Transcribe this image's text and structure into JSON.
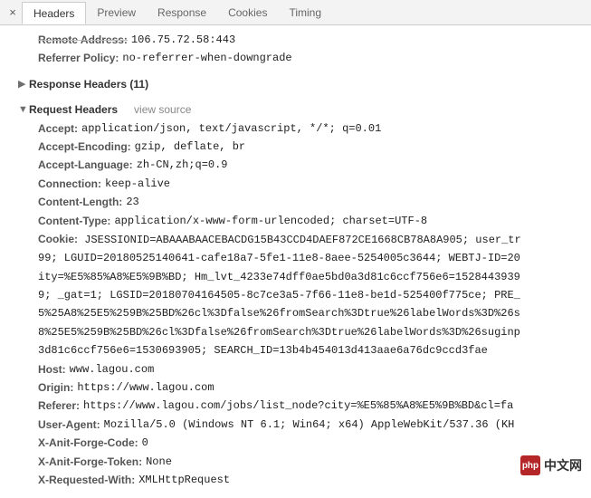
{
  "tabs": {
    "close": "×",
    "items": [
      "Headers",
      "Preview",
      "Response",
      "Cookies",
      "Timing"
    ]
  },
  "general": {
    "remote_address_label": "Remote Address:",
    "remote_address_value": "106.75.72.58:443",
    "referrer_policy_label": "Referrer Policy:",
    "referrer_policy_value": "no-referrer-when-downgrade"
  },
  "response_section": {
    "arrow": "▶",
    "title": "Response Headers (11)"
  },
  "request_section": {
    "arrow": "▼",
    "title": "Request Headers",
    "view_source": "view source"
  },
  "headers": {
    "accept": {
      "label": "Accept:",
      "value": "application/json, text/javascript, */*; q=0.01"
    },
    "accept_encoding": {
      "label": "Accept-Encoding:",
      "value": "gzip, deflate, br"
    },
    "accept_language": {
      "label": "Accept-Language:",
      "value": "zh-CN,zh;q=0.9"
    },
    "connection": {
      "label": "Connection:",
      "value": "keep-alive"
    },
    "content_length": {
      "label": "Content-Length:",
      "value": "23"
    },
    "content_type": {
      "label": "Content-Type:",
      "value": "application/x-www-form-urlencoded; charset=UTF-8"
    },
    "cookie_label": "Cookie:",
    "cookie_value": " JSESSIONID=ABAAABAACEBACDG15B43CCD4DAEF872CE1668CB78A8A905; user_tr\n99; LGUID=20180525140641-cafe18a7-5fe1-11e8-8aee-5254005c3644; WEBTJ-ID=20\nity=%E5%85%A8%E5%9B%BD; Hm_lvt_4233e74dff0ae5bd0a3d81c6ccf756e6=1528443939\n9; _gat=1; LGSID=20180704164505-8c7ce3a5-7f66-11e8-be1d-525400f775ce; PRE_\n5%25A8%25E5%259B%25BD%26cl%3Dfalse%26fromSearch%3Dtrue%26labelWords%3D%26s\n8%25E5%259B%25BD%26cl%3Dfalse%26fromSearch%3Dtrue%26labelWords%3D%26suginp\n3d81c6ccf756e6=1530693905; SEARCH_ID=13b4b454013d413aae6a76dc9ccd3fae",
    "host": {
      "label": "Host:",
      "value": "www.lagou.com"
    },
    "origin": {
      "label": "Origin:",
      "value": "https://www.lagou.com"
    },
    "referer": {
      "label": "Referer:",
      "value": "https://www.lagou.com/jobs/list_node?city=%E5%85%A8%E5%9B%BD&cl=fa"
    },
    "user_agent": {
      "label": "User-Agent:",
      "value": "Mozilla/5.0 (Windows NT 6.1; Win64; x64) AppleWebKit/537.36 (KH"
    },
    "x_anit_forge_code": {
      "label": "X-Anit-Forge-Code:",
      "value": "0"
    },
    "x_anit_forge_token": {
      "label": "X-Anit-Forge-Token:",
      "value": "None"
    },
    "x_requested_with": {
      "label": "X-Requested-With:",
      "value": "XMLHttpRequest"
    }
  },
  "watermark": {
    "logo": "php",
    "text": "中文网"
  }
}
